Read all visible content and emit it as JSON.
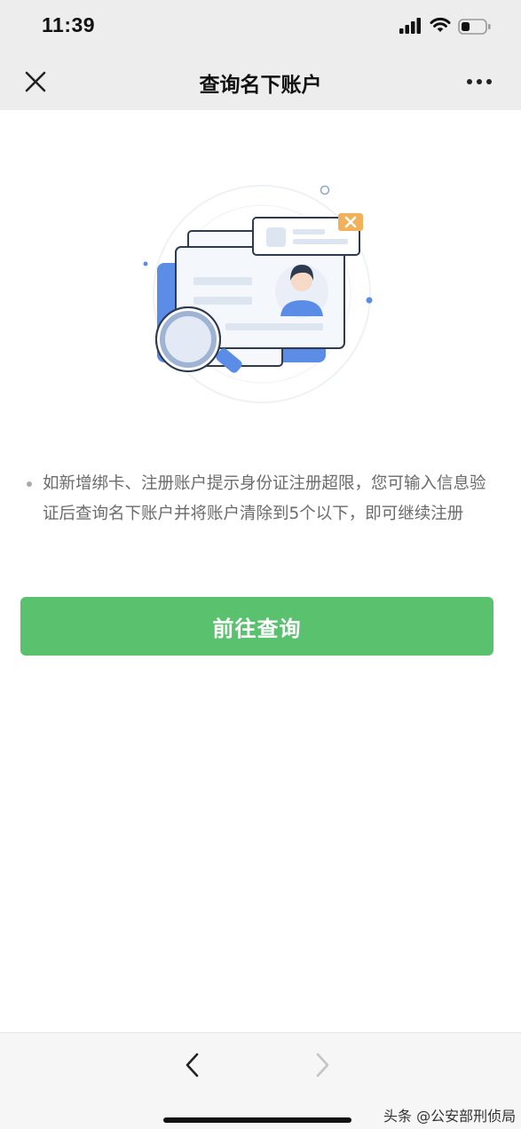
{
  "status_bar": {
    "time": "11:39"
  },
  "nav": {
    "title": "查询名下账户",
    "close_icon": "close-icon",
    "more_icon": "more-icon"
  },
  "content": {
    "notice": "如新增绑卡、注册账户提示身份证注册超限，您可输入信息验证后查询名下账户并将账户清除到5个以下，即可继续注册",
    "button_label": "前往查询"
  },
  "bottom_nav": {
    "back_icon": "chevron-left-icon",
    "forward_icon": "chevron-right-icon"
  },
  "watermark": "头条 @公安部刑侦局",
  "colors": {
    "primary": "#5ac26f",
    "nav_bg": "#ededed",
    "accent_blue": "#5b8de6",
    "accent_orange": "#f0b15a"
  }
}
